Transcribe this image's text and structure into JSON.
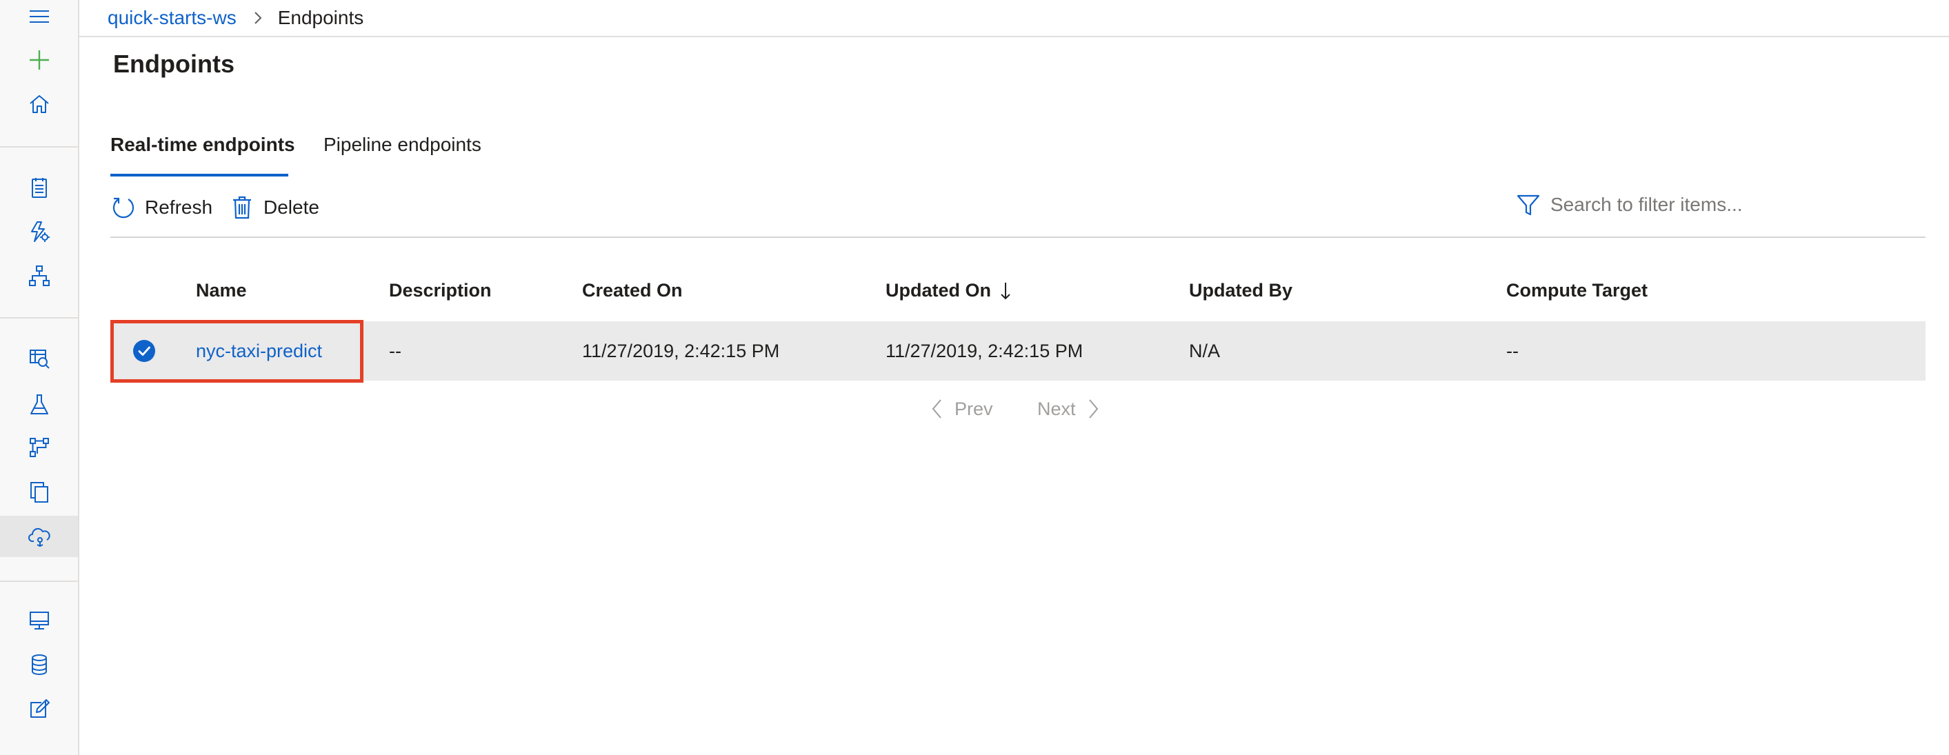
{
  "breadcrumb": {
    "workspace": "quick-starts-ws",
    "current": "Endpoints"
  },
  "page": {
    "title": "Endpoints"
  },
  "tabs": [
    {
      "label": "Real-time endpoints",
      "active": true
    },
    {
      "label": "Pipeline endpoints",
      "active": false
    }
  ],
  "toolbar": {
    "refresh_label": "Refresh",
    "delete_label": "Delete",
    "search_placeholder": "Search to filter items..."
  },
  "table": {
    "columns": [
      "Name",
      "Description",
      "Created On",
      "Updated On",
      "Updated By",
      "Compute Target"
    ],
    "sort_column": "Updated On",
    "sort_direction": "descending",
    "rows": [
      {
        "selected": true,
        "name": "nyc-taxi-predict",
        "description": "--",
        "created_on": "11/27/2019, 2:42:15 PM",
        "updated_on": "11/27/2019, 2:42:15 PM",
        "updated_by": "N/A",
        "compute_target": "--"
      }
    ]
  },
  "pagination": {
    "prev_label": "Prev",
    "next_label": "Next"
  },
  "sidebar": {
    "icons": [
      "menu-icon",
      "create-new-icon",
      "home-icon",
      "notebooks-icon",
      "automated-ml-icon",
      "designer-icon",
      "datasets-icon",
      "experiments-icon",
      "pipelines-icon",
      "models-icon",
      "endpoints-icon",
      "compute-icon",
      "datastores-icon",
      "data-labeling-icon"
    ],
    "selected": "endpoints-icon"
  },
  "colors": {
    "accent": "#0f62c9",
    "highlight_box": "#e43f26",
    "selected_row": "#eaeaea",
    "rail_background": "#f8f8f8",
    "create_icon": "#4caf50"
  }
}
